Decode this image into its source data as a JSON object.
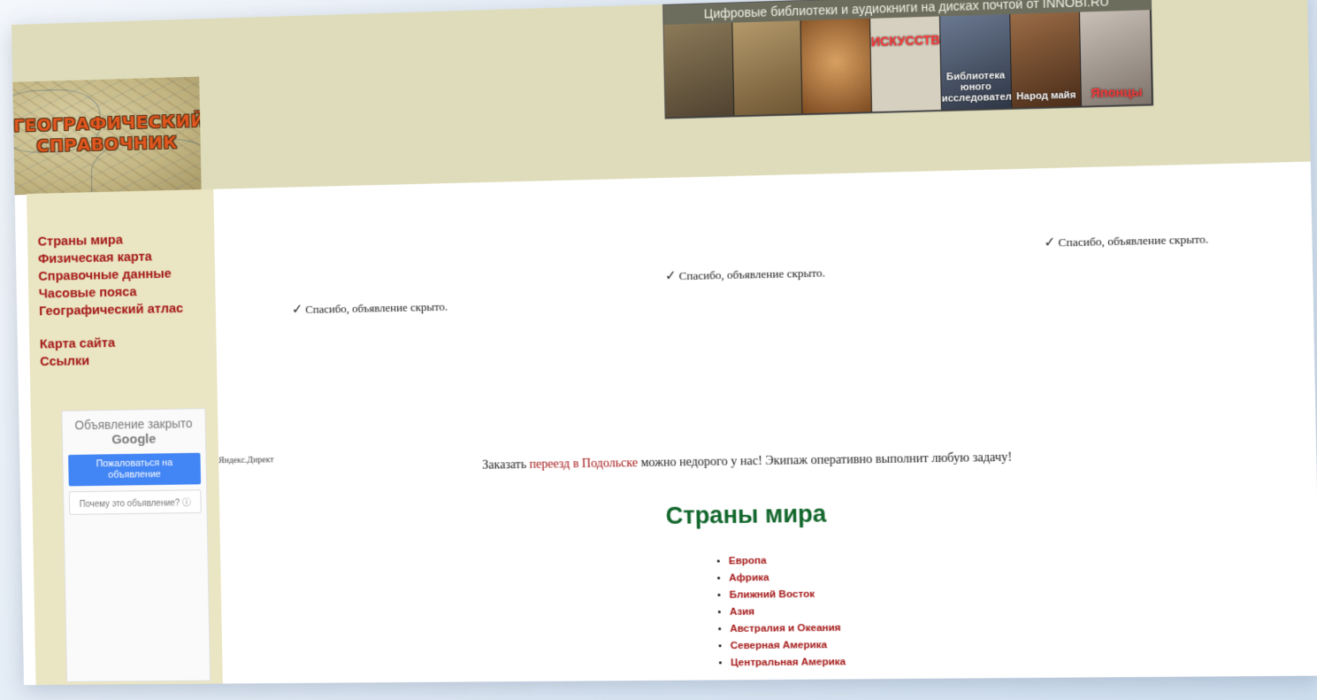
{
  "banner": {
    "caption": "Цифровые библиотеки и аудиокниги на дисках почтой от INNOBI.RU",
    "tiles": [
      {
        "label": ""
      },
      {
        "label": ""
      },
      {
        "label": ""
      },
      {
        "label": "ИСКУССТВ"
      },
      {
        "label": "Библиотека юного исследователя"
      },
      {
        "label": "Народ майя"
      },
      {
        "label": "Японцы"
      }
    ],
    "colors": [
      "#6b5a3e",
      "#8a6e45",
      "#b57a3a",
      "#c8c2b0",
      "#4e5a6e",
      "#7a4e2e",
      "#9a8f86"
    ]
  },
  "logo": {
    "line1": "ГЕОГРАФИЧЕСКИЙ",
    "line2": "СПРАВОЧНИК"
  },
  "nav": {
    "items": [
      "Страны мира",
      "Физическая карта",
      "Справочные данные",
      "Часовые пояса",
      "Географический атлас"
    ],
    "extra": [
      "Карта сайта",
      "Ссылки"
    ]
  },
  "ad": {
    "closed": "Объявление закрыто",
    "brand": "Google",
    "report": "Пожаловаться на объявление",
    "why": "Почему это объявление? ⓘ"
  },
  "hidden_ads": [
    "Спасибо, объявление скрыто.",
    "Спасибо, объявление скрыто.",
    "Спасибо, объявление скрыто."
  ],
  "yandex": "Яндекс.Директ",
  "promo": {
    "before": "Заказать ",
    "link": "переезд в Подольске",
    "after": " можно недорого у нас! Экипаж оперативно выполнит любую задачу!"
  },
  "section_title": "Страны мира",
  "countries": [
    "Европа",
    "Африка",
    "Ближний Восток",
    "Азия",
    "Австралия и Океания",
    "Северная Америка",
    "Центральная Америка"
  ],
  "colors": {
    "nav_link": "#a31515",
    "title": "#10652a",
    "header_bg": "#dedcba",
    "sidebar_bg": "#eae5c2"
  }
}
